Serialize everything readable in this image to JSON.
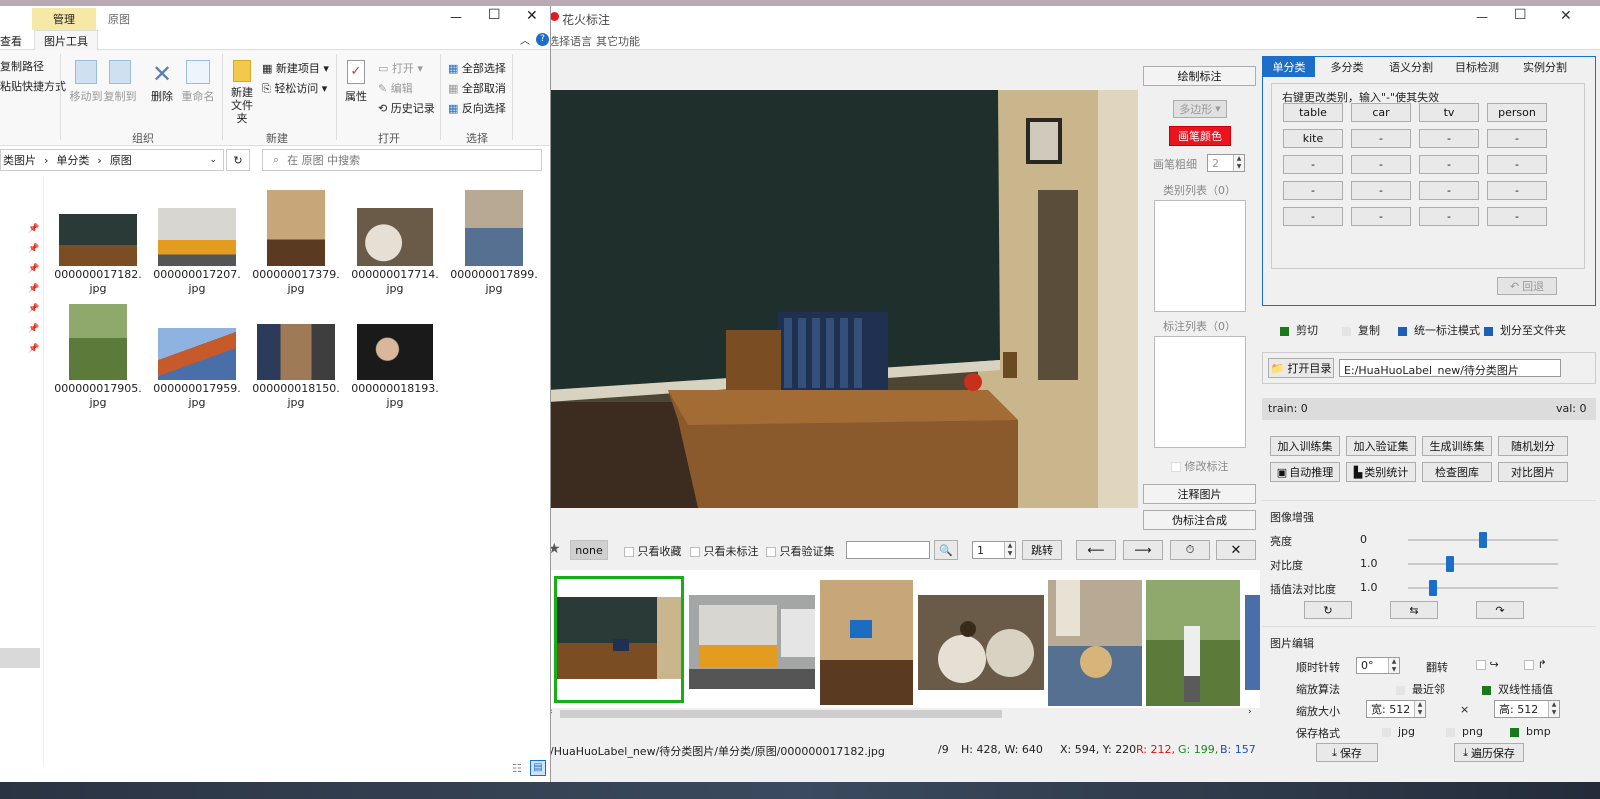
{
  "explorer": {
    "ribbon_context_tab": "管理",
    "ribbon_path_label": "原图",
    "tabs": {
      "view": "查看",
      "picture_tools": "图片工具"
    },
    "clipboard": {
      "copy_path": "复制路径",
      "paste_shortcut": "粘贴快捷方式"
    },
    "organize": {
      "move_to": "移动到",
      "copy_to": "复制到",
      "delete": "删除",
      "rename": "重命名",
      "group": "组织"
    },
    "new": {
      "new_item": "新建项目",
      "easy_access": "轻松访问",
      "new_folder": "新建\n文件夹",
      "group": "新建"
    },
    "open": {
      "properties": "属性",
      "open": "打开",
      "edit": "编辑",
      "history": "历史记录",
      "group": "打开"
    },
    "select": {
      "select_all": "全部选择",
      "select_none": "全部取消",
      "invert": "反向选择",
      "group": "选择"
    },
    "breadcrumb": [
      "类图片",
      "单分类",
      "原图"
    ],
    "search_placeholder": "在 原图 中搜索",
    "files": [
      "000000017182.jpg",
      "000000017207.jpg",
      "000000017379.jpg",
      "000000017714.jpg",
      "000000017899.jpg",
      "000000017905.jpg",
      "000000017959.jpg",
      "000000018150.jpg",
      "000000018193.jpg"
    ]
  },
  "app": {
    "title": "花火标注",
    "menu": {
      "language": "选择语言",
      "other": "其它功能"
    },
    "middle": {
      "draw_title": "绘制标注",
      "shape": "多边形",
      "color_btn": "画笔颜色",
      "brush_label": "画笔粗细",
      "brush_value": "2",
      "class_list": "类别列表（0）",
      "anno_list": "标注列表（0）",
      "modify": "修改标注",
      "annotate_image": "注释图片",
      "pseudo": "伪标注合成"
    },
    "right": {
      "tabs": [
        "单分类",
        "多分类",
        "语义分割",
        "目标检测",
        "实例分割"
      ],
      "hint": "右键更改类别，输入\"-\"使其失效",
      "classes": [
        "table",
        "car",
        "tv",
        "person",
        "kite",
        "-",
        "-",
        "-",
        "-",
        "-",
        "-",
        "-",
        "-",
        "-",
        "-",
        "-",
        "-",
        "-",
        "-",
        "-"
      ],
      "undo": "回退",
      "options": {
        "cut": "剪切",
        "copy": "复制",
        "unify": "统一标注模式",
        "split_folder": "划分至文件夹"
      },
      "open_dir": "打开目录",
      "dir_path": "E:/HuaHuoLabel_new/待分类图片",
      "train": "train: 0",
      "val": "val: 0",
      "actions": [
        "加入训练集",
        "加入验证集",
        "生成训练集",
        "随机划分",
        "自动推理",
        "类别统计",
        "检查图库",
        "对比图片"
      ],
      "enhance_title": "图像增强",
      "brightness_label": "亮度",
      "brightness_value": "0",
      "contrast_label": "对比度",
      "contrast_value": "1.0",
      "interp_contrast_label": "插值法对比度",
      "interp_contrast_value": "1.0",
      "brightness_level": 0.5,
      "contrast_level": 0.27,
      "interp_level": 0.15,
      "edit_title": "图片编辑",
      "rotate_label": "顺时针转",
      "rotate_value": "0°",
      "flip_label": "翻转",
      "scale_algo_label": "缩放算法",
      "nearest": "最近邻",
      "bilinear": "双线性插值",
      "scale_size_label": "缩放大小",
      "width_value": "宽: 512",
      "times": "×",
      "height_value": "高: 512",
      "save_format_label": "保存格式",
      "formats": [
        "jpg",
        "png",
        "bmp"
      ],
      "save": "保存",
      "batch_save": "遍历保存"
    },
    "toolbar": {
      "none": "none",
      "only_fav": "只看收藏",
      "only_unlabeled": "只看未标注",
      "only_val": "只看验证集",
      "page_value": "1",
      "jump": "跳转"
    },
    "status": {
      "path": "/HuaHuoLabel_new/待分类图片/单分类/原图/000000017182.jpg",
      "count": "/9",
      "size": "H: 428, W: 640",
      "pos": "X: 594, Y: 220",
      "r": "R: 212,",
      "g": "G: 199,",
      "b": "B: 157"
    }
  },
  "colors": {
    "accent": "#1d6ec8",
    "red_btn": "#e8141e",
    "green": "#1a7a1a",
    "selected_border": "#16b016"
  }
}
